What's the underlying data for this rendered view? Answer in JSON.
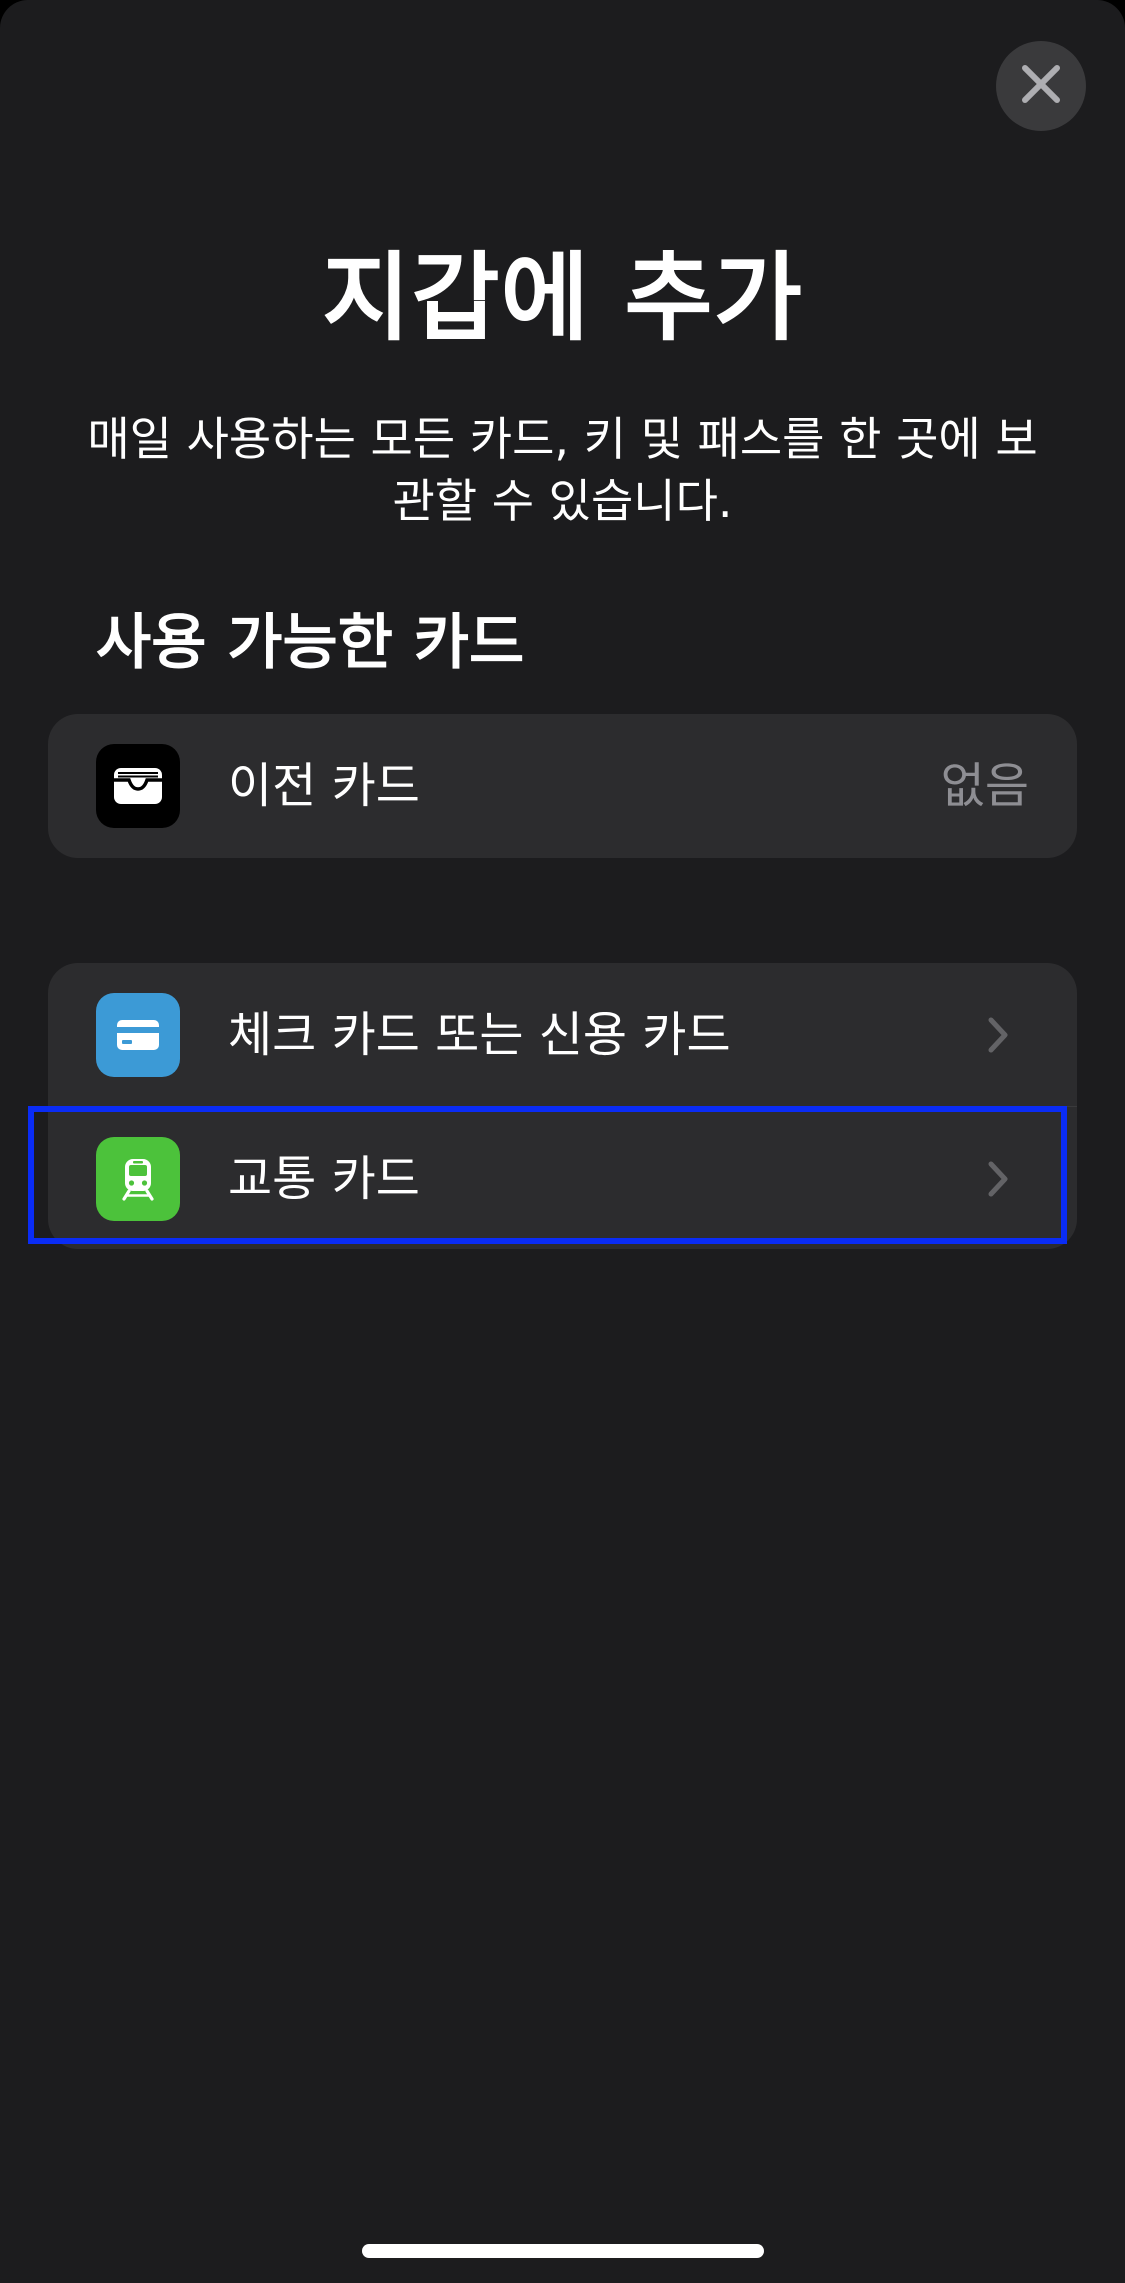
{
  "header": {
    "close_icon": "close-icon"
  },
  "title": "지갑에 추가",
  "subtitle": "매일 사용하는 모든 카드, 키 및 패스를 한 곳에 보관할 수 있습니다.",
  "section": {
    "title": "사용 가능한 카드"
  },
  "available_cards": [
    {
      "label": "이전 카드",
      "value": "없음",
      "icon": "wallet-icon",
      "icon_bg": "#000000"
    }
  ],
  "add_options": [
    {
      "label": "체크 카드 또는 신용 카드",
      "icon": "credit-card-icon",
      "icon_bg": "#3c9ad6",
      "chevron": "chevron-right-icon"
    },
    {
      "label": "교통 카드",
      "icon": "train-icon",
      "icon_bg": "#4cc23b",
      "chevron": "chevron-right-icon",
      "highlighted": true
    }
  ],
  "colors": {
    "background": "#1c1c1e",
    "cell": "#2c2c2e",
    "secondary_text": "#8e8e93",
    "highlight_border": "#0a2cf5"
  }
}
